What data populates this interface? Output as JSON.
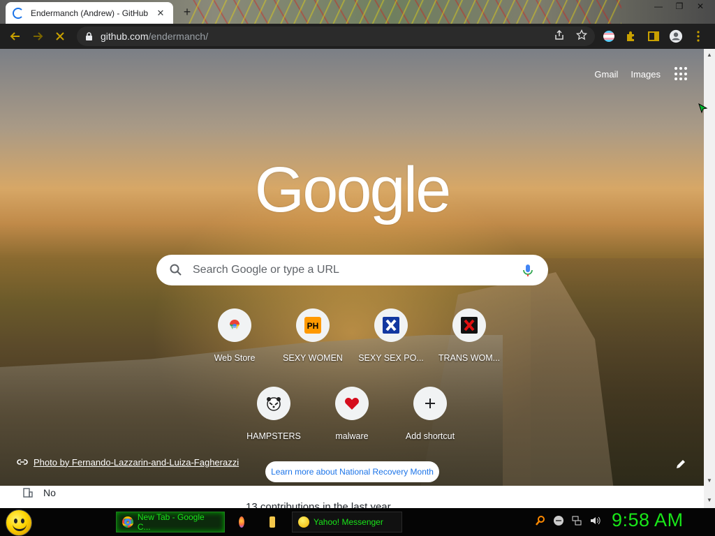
{
  "browser": {
    "tab": {
      "title": "Endermanch (Andrew) - GitHub",
      "close": "✕"
    },
    "new_tab_symbol": "+",
    "window_controls": [
      "—",
      "❐",
      "✕"
    ],
    "url": {
      "host": "github.com",
      "path": "/endermanch/"
    }
  },
  "ntp": {
    "top_links": {
      "gmail": "Gmail",
      "images": "Images"
    },
    "logo": "Google",
    "search_placeholder": "Search Google or type a URL",
    "shortcuts_row1": [
      {
        "label": "Web Store",
        "icon": "web-store-icon"
      },
      {
        "label": "SEXY WOMEN",
        "icon": "ph-icon"
      },
      {
        "label": "SEXY SEX PO...",
        "icon": "x-blue-icon"
      },
      {
        "label": "TRANS WOM...",
        "icon": "x-red-icon"
      }
    ],
    "shortcuts_row2": [
      {
        "label": "HAMPSTERS",
        "icon": "hamster-icon"
      },
      {
        "label": "malware",
        "icon": "heart-icon"
      },
      {
        "label": "Add shortcut",
        "icon": "plus-icon"
      }
    ],
    "credit": "Photo by Fernando-Lazzarin-and-Luiza-Fagherazzi",
    "learn_more": "Learn more about National Recovery Month"
  },
  "github_peek": {
    "company": "No",
    "contributions": "13 contributions in the last year"
  },
  "taskbar": {
    "items": [
      {
        "label": "New Tab - Google C...",
        "icon": "chrome-icon"
      },
      {
        "label": "",
        "icon": "firefox-icon"
      },
      {
        "label": "",
        "icon": "folder-icon"
      },
      {
        "label": "Yahoo! Messenger",
        "icon": "yahoo-messenger-icon"
      }
    ],
    "clock": "9:58 AM"
  },
  "colors": {
    "accent_green": "#19e619",
    "link_blue": "#1a73e8",
    "toolbar_bg": "#1f1f1f"
  }
}
